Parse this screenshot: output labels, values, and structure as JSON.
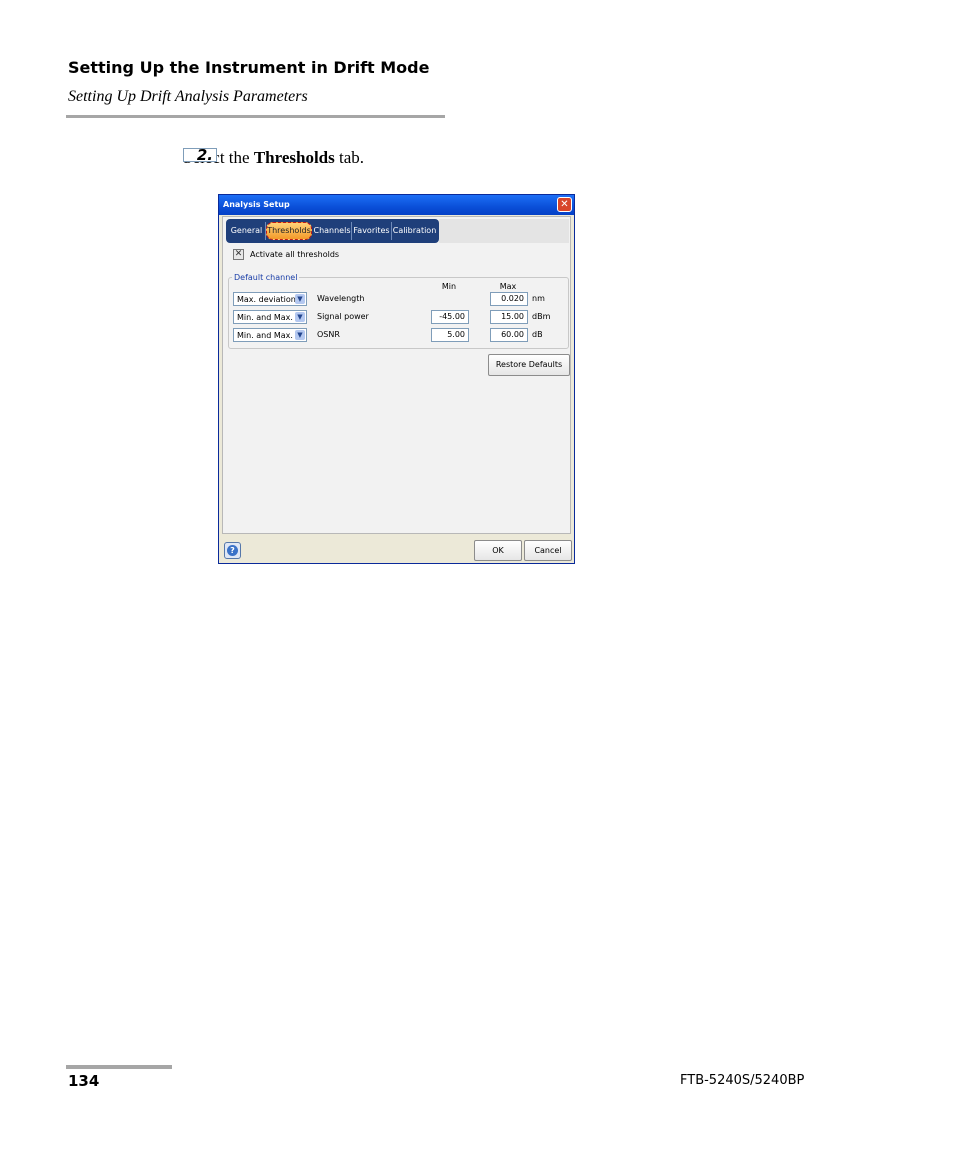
{
  "header": {
    "title": "Setting Up the Instrument in Drift Mode",
    "subtitle": "Setting Up Drift Analysis Parameters"
  },
  "step": {
    "number": "2.",
    "text_before": "Select the ",
    "text_bold": "Thresholds",
    "text_after": " tab."
  },
  "dialog": {
    "title": "Analysis Setup",
    "tabs": [
      "General",
      "Thresholds",
      "Channels",
      "Favorites",
      "Calibration"
    ],
    "active_tab": "Thresholds",
    "activate_all_label": "Activate all thresholds",
    "activate_all_checked": true,
    "group_label": "Default channel",
    "col_min": "Min",
    "col_max": "Max",
    "rows": [
      {
        "mode": "Max. deviation",
        "label": "Wavelength",
        "min": "",
        "max": "0.020",
        "unit": "nm"
      },
      {
        "mode": "Min. and Max.",
        "label": "Signal power",
        "min": "-45.00",
        "max": "15.00",
        "unit": "dBm"
      },
      {
        "mode": "Min. and Max.",
        "label": "OSNR",
        "min": "5.00",
        "max": "60.00",
        "unit": "dB"
      }
    ],
    "restore_label": "Restore Defaults",
    "ok_label": "OK",
    "cancel_label": "Cancel",
    "help_icon": "?",
    "close_icon": "✕"
  },
  "footer": {
    "page_number": "134",
    "product": "FTB-5240S/5240BP"
  }
}
